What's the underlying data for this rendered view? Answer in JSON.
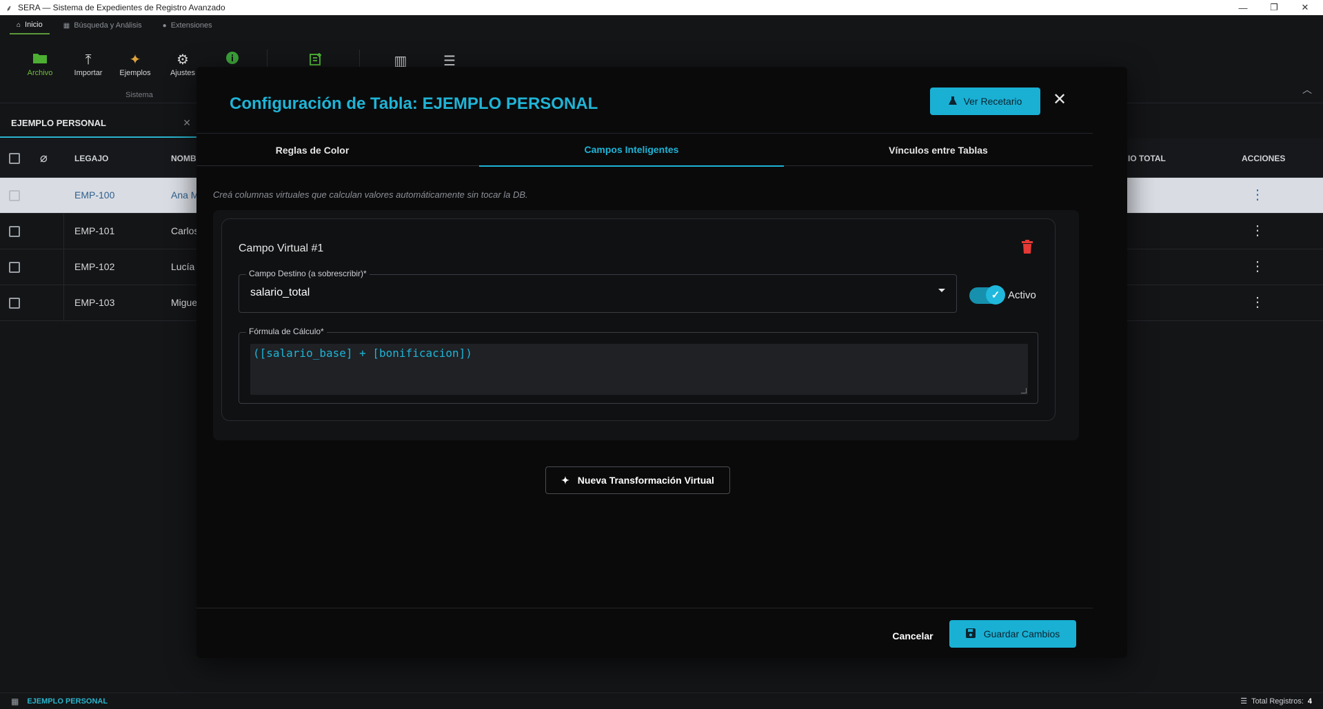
{
  "window": {
    "title": "SERA — Sistema de Expedientes de Registro Avanzado",
    "app_icon": "⸙",
    "minimize": "—",
    "maximize": "❐",
    "close": "✕"
  },
  "ribbon": {
    "tabs": [
      {
        "label": "Inicio",
        "icon": "home-icon",
        "active": true
      },
      {
        "label": "Búsqueda y Análisis",
        "icon": "table-icon",
        "active": false
      },
      {
        "label": "Extensiones",
        "icon": "puzzle-icon",
        "active": false
      }
    ],
    "buttons": [
      {
        "label": "Archivo",
        "icon": "folder-icon",
        "color": "#6fbf3c"
      },
      {
        "label": "Importar",
        "icon": "upload-icon"
      },
      {
        "label": "Ejemplos",
        "icon": "sparkles-icon",
        "color": "#e0a23a"
      },
      {
        "label": "Ajustes",
        "icon": "gear-icon"
      },
      {
        "label": "",
        "icon": "info-icon",
        "color": "#3ca33a"
      }
    ],
    "group_label": "Sistema",
    "extra_icons": [
      "note-add-icon",
      "columns-icon",
      "sliders-icon"
    ]
  },
  "document_tab": {
    "label": "EJEMPLO PERSONAL"
  },
  "table": {
    "headers": {
      "legajo": "LEGAJO",
      "nombre": "NOMBI",
      "salario": "IO TOTAL",
      "acciones": "ACCIONES"
    },
    "rows": [
      {
        "legajo": "EMP-100",
        "nombre": "Ana M",
        "selected": true
      },
      {
        "legajo": "EMP-101",
        "nombre": "Carlos",
        "selected": false
      },
      {
        "legajo": "EMP-102",
        "nombre": "Lucía",
        "selected": false
      },
      {
        "legajo": "EMP-103",
        "nombre": "Migue",
        "selected": false
      }
    ]
  },
  "modal": {
    "title": "Configuración de Tabla: EJEMPLO PERSONAL",
    "recetario_button": "Ver Recetario",
    "tabs": [
      {
        "label": "Reglas de Color",
        "active": false
      },
      {
        "label": "Campos Inteligentes",
        "active": true
      },
      {
        "label": "Vínculos entre Tablas",
        "active": false
      }
    ],
    "hint": "Creá columnas virtuales que calculan valores automáticamente sin tocar la DB.",
    "virtual_field": {
      "title": "Campo Virtual #1",
      "target_label": "Campo Destino (a sobrescribir)*",
      "target_value": "salario_total",
      "active_label": "Activo",
      "active": true,
      "formula_label": "Fórmula de Cálculo*",
      "formula_value": "([salario_base] + [bonificacion])"
    },
    "new_button": "Nueva Transformación Virtual",
    "cancel_button": "Cancelar",
    "save_button": "Guardar Cambios"
  },
  "status": {
    "table_name": "EJEMPLO PERSONAL",
    "total_label": "Total Registros:",
    "total_value": "4"
  },
  "colors": {
    "accent": "#1fb4d6",
    "background": "#141517",
    "modal": "#0a0a0b",
    "danger": "#e53935"
  }
}
